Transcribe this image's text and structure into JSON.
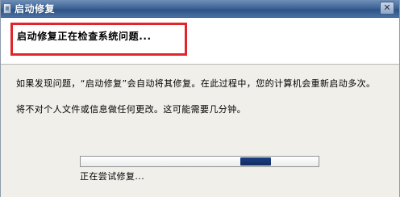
{
  "window": {
    "title": "启动修复",
    "close_glyph": "✕"
  },
  "header": {
    "title": "启动修复正在检查系统问题..."
  },
  "body": {
    "paragraph1": "如果发现问题，“启动修复”会自动将其修复。在此过程中，您的计算机会重新启动多次。",
    "paragraph2": "将不对个人文件或信息做任何更改。这可能需要几分钟。"
  },
  "progress": {
    "marquee_position": 0.67,
    "marquee_width": 0.13,
    "status_text": "正在尝试修复..."
  },
  "colors": {
    "highlight_border": "#e0262b",
    "title_bar": "#3f6596",
    "progress_fill": "#1c3f83"
  },
  "icons": {
    "window_icon": "window-app-icon",
    "close_icon": "close-icon"
  }
}
